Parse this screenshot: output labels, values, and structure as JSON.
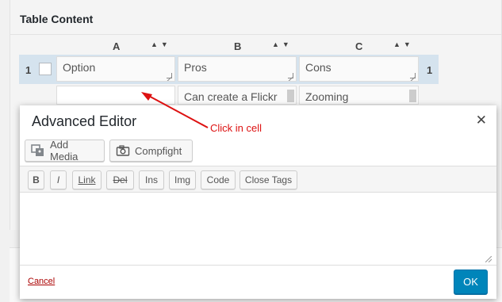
{
  "panel": {
    "title": "Table Content"
  },
  "table": {
    "columns": [
      {
        "label": "A",
        "sort_arrows": "▲▼"
      },
      {
        "label": "B",
        "sort_arrows": "▲▼"
      },
      {
        "label": "C",
        "sort_arrows": "▲▼"
      }
    ],
    "rows": [
      {
        "number": "1",
        "cells": [
          "Option",
          "Pros",
          "Cons"
        ]
      },
      {
        "number": "",
        "cells": [
          "",
          "Can create a Flickr",
          "Zooming"
        ]
      }
    ]
  },
  "annotation": {
    "text": "Click in cell",
    "color": "#dd1111"
  },
  "modal": {
    "title": "Advanced Editor",
    "close_symbol": "✕",
    "media_buttons": [
      "Add Media",
      "Compfight"
    ],
    "quicktags": [
      "B",
      "I",
      "Link",
      "Del",
      "Ins",
      "Img",
      "Code",
      "Close Tags"
    ],
    "cancel_label": "Cancel",
    "ok_label": "OK"
  },
  "colors": {
    "accent": "#0085ba",
    "row_highlight": "#d5e3ee",
    "cancel_link": "#aa0000"
  }
}
